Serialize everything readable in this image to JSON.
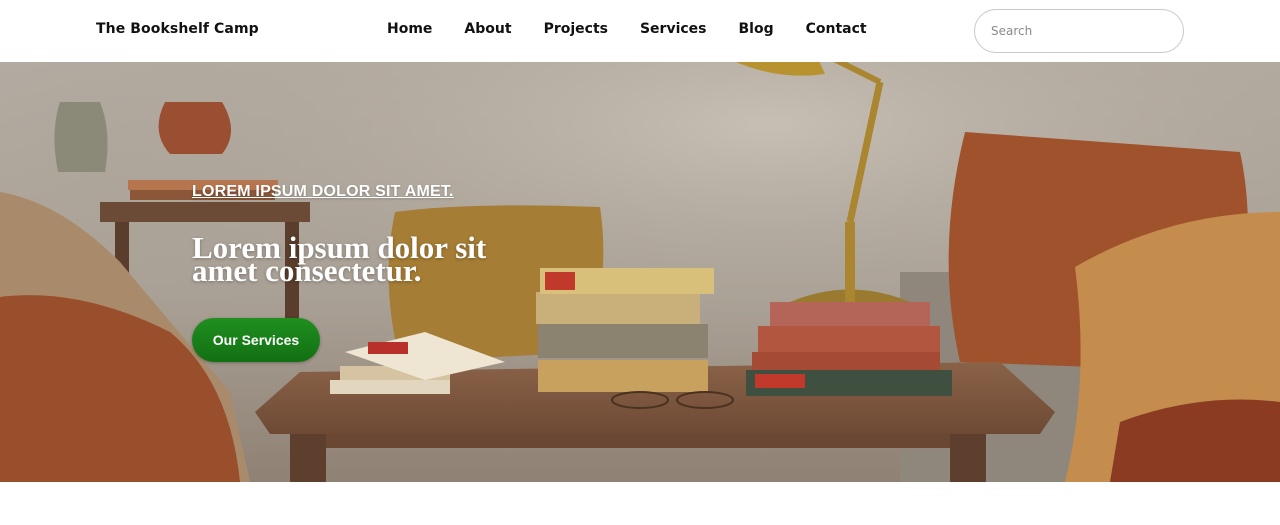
{
  "header": {
    "brand": "The Bookshelf Camp",
    "nav": [
      {
        "label": "Home"
      },
      {
        "label": "About"
      },
      {
        "label": "Projects"
      },
      {
        "label": "Services"
      },
      {
        "label": "Blog"
      },
      {
        "label": "Contact"
      }
    ],
    "search": {
      "placeholder": "Search",
      "value": ""
    }
  },
  "hero": {
    "eyebrow": "LOREM IPSUM DOLOR SIT AMET.",
    "headline": "Lorem ipsum dolor sit amet consectetur.",
    "cta_label": "Our Services"
  },
  "colors": {
    "cta": "#1a8a1a",
    "header_bg": "#ffffff",
    "text_dark": "#111111"
  }
}
